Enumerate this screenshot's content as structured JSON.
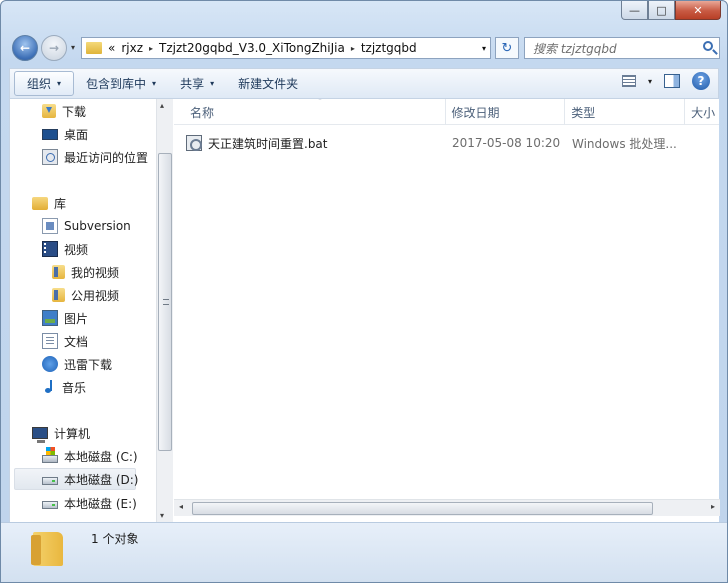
{
  "window": {
    "minimize_label": "—",
    "maximize_label": "□",
    "close_label": "✕"
  },
  "nav_buttons": {
    "back_glyph": "←",
    "forward_glyph": "→",
    "dropdown_glyph": "▾"
  },
  "address": {
    "overflow": "«",
    "segments": [
      "rjxz",
      "Tzjzt20gqbd_V3.0_XiTongZhiJia",
      "tzjztgqbd"
    ],
    "separator": "▸",
    "dropdown": "▾",
    "refresh_glyph": "↻"
  },
  "search": {
    "placeholder": "搜索 tzjztgqbd"
  },
  "toolbar": {
    "organize": "组织",
    "include_in_library": "包含到库中",
    "share": "共享",
    "new_folder": "新建文件夹",
    "arrow": "▾",
    "help": "?"
  },
  "sidebar": {
    "items": [
      {
        "label": "下载",
        "icon": "download-folder-icon"
      },
      {
        "label": "桌面",
        "icon": "desktop-icon"
      },
      {
        "label": "最近访问的位置",
        "icon": "recent-places-icon"
      },
      {
        "label": "库",
        "icon": "library-icon"
      },
      {
        "label": "Subversion",
        "icon": "subversion-icon"
      },
      {
        "label": "视频",
        "icon": "video-icon"
      },
      {
        "label": "我的视频",
        "icon": "video-folder-icon"
      },
      {
        "label": "公用视频",
        "icon": "video-folder-icon"
      },
      {
        "label": "图片",
        "icon": "pictures-icon"
      },
      {
        "label": "文档",
        "icon": "documents-icon"
      },
      {
        "label": "迅雷下载",
        "icon": "thunder-icon"
      },
      {
        "label": "音乐",
        "icon": "music-icon"
      },
      {
        "label": "计算机",
        "icon": "computer-icon"
      },
      {
        "label": "本地磁盘 (C:)",
        "icon": "system-drive-icon"
      },
      {
        "label": "本地磁盘 (D:)",
        "icon": "drive-icon"
      },
      {
        "label": "本地磁盘 (E:)",
        "icon": "drive-icon"
      }
    ],
    "selected_index": 14
  },
  "columns": [
    "名称",
    "修改日期",
    "类型",
    "大小"
  ],
  "sort_glyph": "˄",
  "files": [
    {
      "name": "天正建筑时间重置.bat",
      "modified": "2017-05-08 10:20",
      "type": "Windows 批处理...",
      "icon": "batch-file-icon"
    }
  ],
  "scroll": {
    "up": "▴",
    "down": "▾",
    "left": "◂",
    "right": "▸",
    "grip": "ⅡⅡⅡ"
  },
  "status": {
    "count": "1 个对象"
  }
}
